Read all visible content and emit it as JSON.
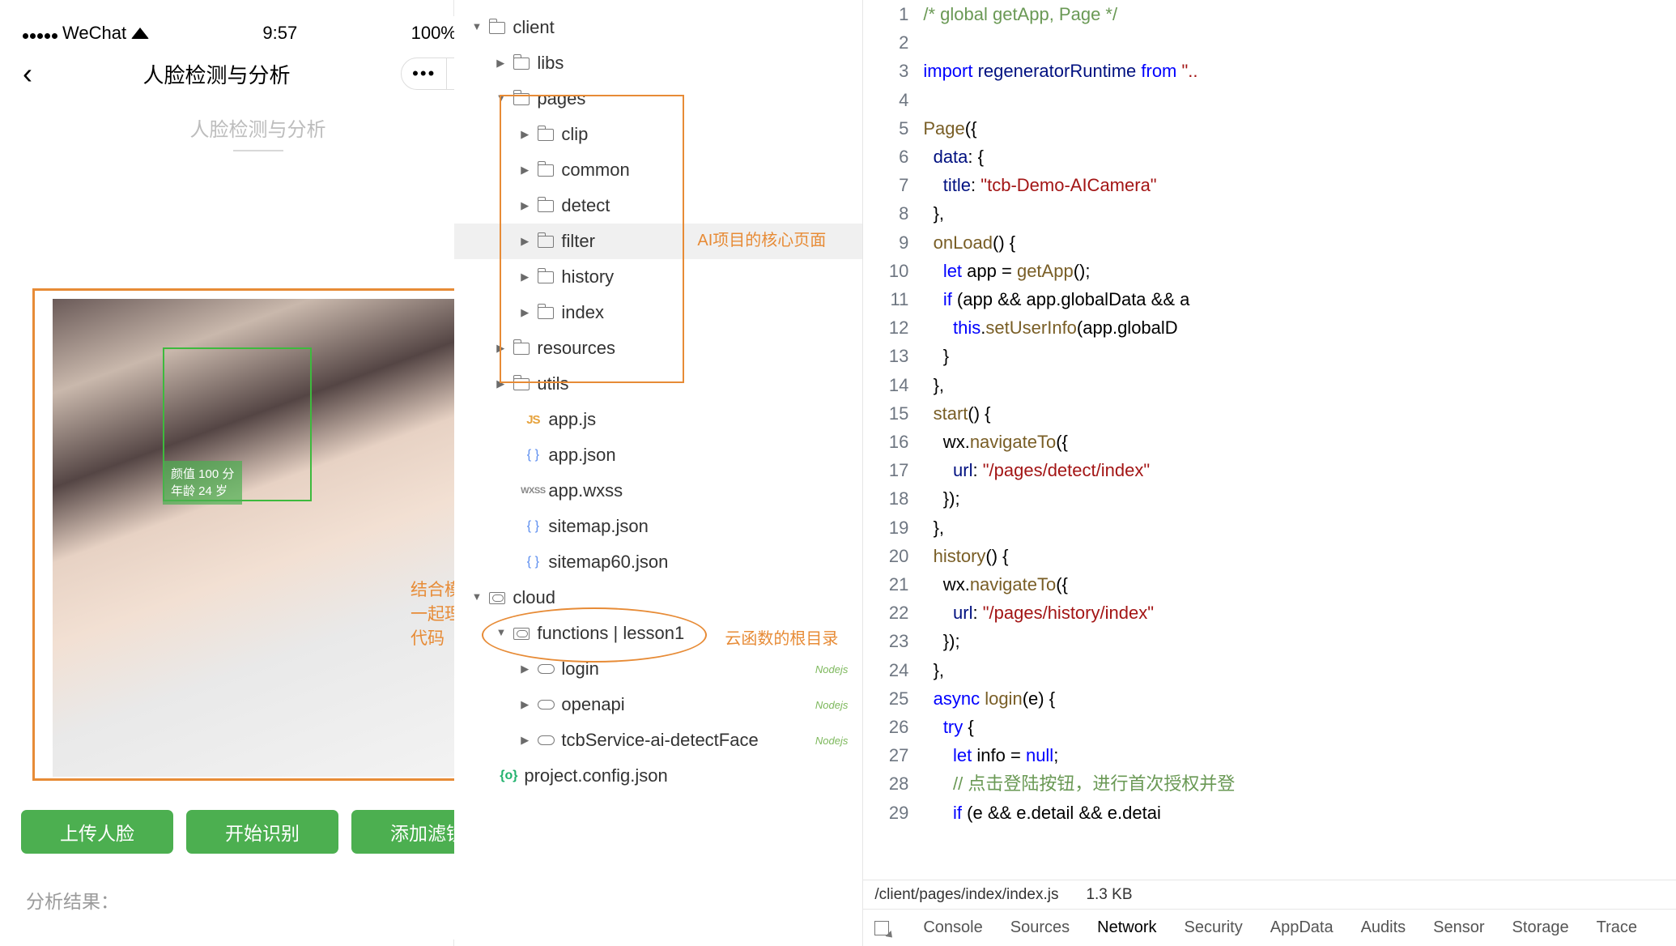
{
  "simulator": {
    "carrier": "WeChat",
    "time": "9:57",
    "battery": "100%",
    "nav_title": "人脸检测与分析",
    "subtitle": "人脸检测与分析",
    "tag_score": "颜值 100 分",
    "tag_age": "年龄 24 岁",
    "annotation": "结合模拟器一起理解源代码",
    "buttons": {
      "upload": "上传人脸",
      "start": "开始识别",
      "filter": "添加滤镜"
    },
    "result_label": "分析结果："
  },
  "tree": {
    "annotation_pages": "AI项目的核心页面",
    "annotation_cloud": "云函数的根目录",
    "nodes": [
      {
        "indent": 20,
        "arrow": "open",
        "icon": "folder",
        "label": "client"
      },
      {
        "indent": 50,
        "arrow": "fold",
        "icon": "folder",
        "label": "libs"
      },
      {
        "indent": 50,
        "arrow": "open",
        "icon": "folder",
        "label": "pages"
      },
      {
        "indent": 80,
        "arrow": "fold",
        "icon": "folder",
        "label": "clip"
      },
      {
        "indent": 80,
        "arrow": "fold",
        "icon": "folder",
        "label": "common"
      },
      {
        "indent": 80,
        "arrow": "fold",
        "icon": "folder",
        "label": "detect"
      },
      {
        "indent": 80,
        "arrow": "fold",
        "icon": "folder",
        "label": "filter",
        "hl": true
      },
      {
        "indent": 80,
        "arrow": "fold",
        "icon": "folder",
        "label": "history"
      },
      {
        "indent": 80,
        "arrow": "fold",
        "icon": "folder",
        "label": "index"
      },
      {
        "indent": 50,
        "arrow": "fold",
        "icon": "folder",
        "label": "resources"
      },
      {
        "indent": 50,
        "arrow": "fold",
        "icon": "folder",
        "label": "utils"
      },
      {
        "indent": 64,
        "arrow": "",
        "icon": "js",
        "label": "app.js"
      },
      {
        "indent": 64,
        "arrow": "",
        "icon": "json",
        "label": "app.json"
      },
      {
        "indent": 64,
        "arrow": "",
        "icon": "wxss",
        "label": "app.wxss"
      },
      {
        "indent": 64,
        "arrow": "",
        "icon": "json",
        "label": "sitemap.json"
      },
      {
        "indent": 64,
        "arrow": "",
        "icon": "json",
        "label": "sitemap60.json"
      },
      {
        "indent": 20,
        "arrow": "open",
        "icon": "cloudfolder",
        "label": "cloud"
      },
      {
        "indent": 50,
        "arrow": "open",
        "icon": "cloudfolder",
        "label": "functions | lesson1"
      },
      {
        "indent": 80,
        "arrow": "fold",
        "icon": "cloud",
        "label": "login",
        "badge": "Nodejs"
      },
      {
        "indent": 80,
        "arrow": "fold",
        "icon": "cloud",
        "label": "openapi",
        "badge": "Nodejs"
      },
      {
        "indent": 80,
        "arrow": "fold",
        "icon": "cloud",
        "label": "tcbService-ai-detectFace",
        "badge": "Nodejs"
      },
      {
        "indent": 34,
        "arrow": "",
        "icon": "proj",
        "label": "project.config.json"
      }
    ]
  },
  "editor": {
    "lines": [
      [
        {
          "t": "/* global getApp, Page */",
          "c": "c-cm"
        }
      ],
      [],
      [
        {
          "t": "import",
          "c": "c-kw"
        },
        {
          "t": " regeneratorRuntime ",
          "c": "c-id"
        },
        {
          "t": "from",
          "c": "c-kw"
        },
        {
          "t": " ",
          "c": "c-pl"
        },
        {
          "t": "\"..",
          "c": "c-str"
        }
      ],
      [],
      [
        {
          "t": "Page",
          "c": "c-fn"
        },
        {
          "t": "({",
          "c": "c-pl"
        }
      ],
      [
        {
          "t": "  data",
          "c": "c-id"
        },
        {
          "t": ": {",
          "c": "c-pl"
        }
      ],
      [
        {
          "t": "    title",
          "c": "c-id"
        },
        {
          "t": ": ",
          "c": "c-pl"
        },
        {
          "t": "\"tcb-Demo-AICamera\"",
          "c": "c-str"
        }
      ],
      [
        {
          "t": "  },",
          "c": "c-pl"
        }
      ],
      [
        {
          "t": "  ",
          "c": "c-pl"
        },
        {
          "t": "onLoad",
          "c": "c-fn"
        },
        {
          "t": "() {",
          "c": "c-pl"
        }
      ],
      [
        {
          "t": "    ",
          "c": "c-pl"
        },
        {
          "t": "let",
          "c": "c-kw"
        },
        {
          "t": " app = ",
          "c": "c-pl"
        },
        {
          "t": "getApp",
          "c": "c-fn"
        },
        {
          "t": "();",
          "c": "c-pl"
        }
      ],
      [
        {
          "t": "    ",
          "c": "c-pl"
        },
        {
          "t": "if",
          "c": "c-kw"
        },
        {
          "t": " (app && app.globalData && a",
          "c": "c-pl"
        }
      ],
      [
        {
          "t": "      ",
          "c": "c-pl"
        },
        {
          "t": "this",
          "c": "c-kw"
        },
        {
          "t": ".",
          "c": "c-pl"
        },
        {
          "t": "setUserInfo",
          "c": "c-fn"
        },
        {
          "t": "(app.globalD",
          "c": "c-pl"
        }
      ],
      [
        {
          "t": "    }",
          "c": "c-pl"
        }
      ],
      [
        {
          "t": "  },",
          "c": "c-pl"
        }
      ],
      [
        {
          "t": "  ",
          "c": "c-pl"
        },
        {
          "t": "start",
          "c": "c-fn"
        },
        {
          "t": "() {",
          "c": "c-pl"
        }
      ],
      [
        {
          "t": "    wx.",
          "c": "c-pl"
        },
        {
          "t": "navigateTo",
          "c": "c-fn"
        },
        {
          "t": "({",
          "c": "c-pl"
        }
      ],
      [
        {
          "t": "      url",
          "c": "c-id"
        },
        {
          "t": ": ",
          "c": "c-pl"
        },
        {
          "t": "\"/pages/detect/index\"",
          "c": "c-str"
        }
      ],
      [
        {
          "t": "    });",
          "c": "c-pl"
        }
      ],
      [
        {
          "t": "  },",
          "c": "c-pl"
        }
      ],
      [
        {
          "t": "  ",
          "c": "c-pl"
        },
        {
          "t": "history",
          "c": "c-fn"
        },
        {
          "t": "() {",
          "c": "c-pl"
        }
      ],
      [
        {
          "t": "    wx.",
          "c": "c-pl"
        },
        {
          "t": "navigateTo",
          "c": "c-fn"
        },
        {
          "t": "({",
          "c": "c-pl"
        }
      ],
      [
        {
          "t": "      url",
          "c": "c-id"
        },
        {
          "t": ": ",
          "c": "c-pl"
        },
        {
          "t": "\"/pages/history/index\"",
          "c": "c-str"
        }
      ],
      [
        {
          "t": "    });",
          "c": "c-pl"
        }
      ],
      [
        {
          "t": "  },",
          "c": "c-pl"
        }
      ],
      [
        {
          "t": "  ",
          "c": "c-pl"
        },
        {
          "t": "async",
          "c": "c-kw"
        },
        {
          "t": " ",
          "c": "c-pl"
        },
        {
          "t": "login",
          "c": "c-fn"
        },
        {
          "t": "(e) {",
          "c": "c-pl"
        }
      ],
      [
        {
          "t": "    ",
          "c": "c-pl"
        },
        {
          "t": "try",
          "c": "c-kw"
        },
        {
          "t": " {",
          "c": "c-pl"
        }
      ],
      [
        {
          "t": "      ",
          "c": "c-pl"
        },
        {
          "t": "let",
          "c": "c-kw"
        },
        {
          "t": " info = ",
          "c": "c-pl"
        },
        {
          "t": "null",
          "c": "c-kw"
        },
        {
          "t": ";",
          "c": "c-pl"
        }
      ],
      [
        {
          "t": "      ",
          "c": "c-pl"
        },
        {
          "t": "// 点击登陆按钮，进行首次授权并登",
          "c": "c-cm"
        }
      ],
      [
        {
          "t": "      ",
          "c": "c-pl"
        },
        {
          "t": "if",
          "c": "c-kw"
        },
        {
          "t": " (e && e.detail && e.detai",
          "c": "c-pl"
        }
      ]
    ],
    "file_path": "/client/pages/index/index.js",
    "file_size": "1.3 KB",
    "tabs": [
      "Console",
      "Sources",
      "Network",
      "Security",
      "AppData",
      "Audits",
      "Sensor",
      "Storage",
      "Trace"
    ],
    "active_tab": "Network"
  }
}
